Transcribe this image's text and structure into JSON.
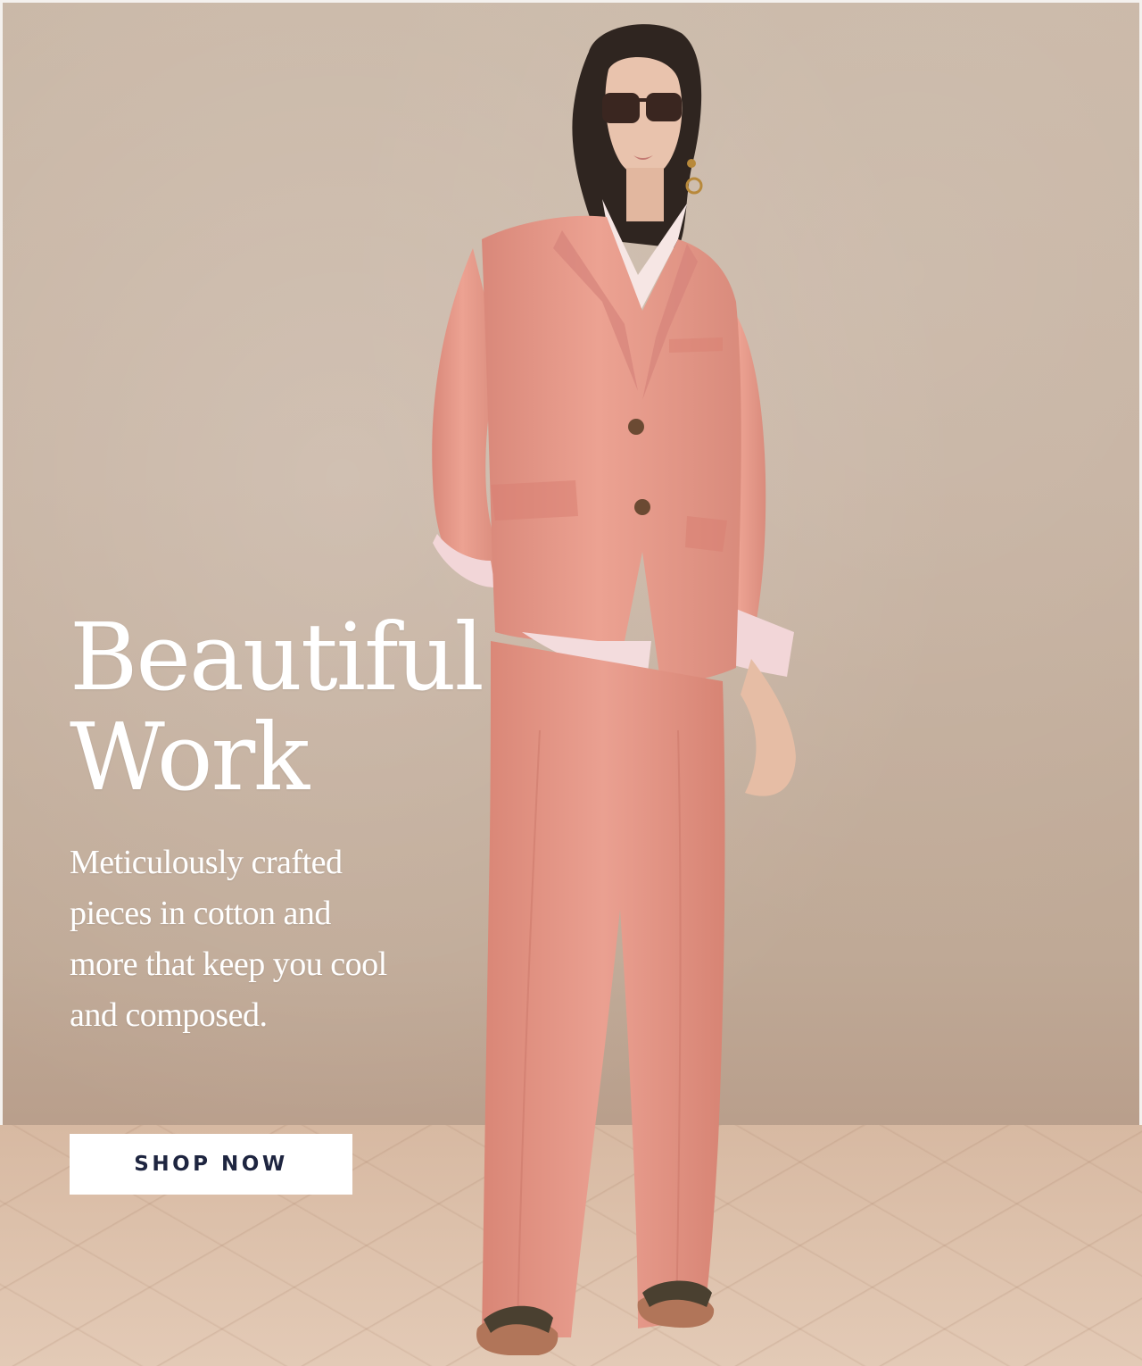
{
  "hero": {
    "headline_line1": "Beautiful",
    "headline_line2": "Work",
    "body": "Meticulously crafted pieces in cotton and more that keep you cool and composed.",
    "cta_label": "SHOP NOW"
  },
  "colors": {
    "suit": "#e69a8b",
    "backdrop": "#c6b2a1",
    "floor": "#dcc0aa",
    "cta_text": "#1e2540"
  }
}
